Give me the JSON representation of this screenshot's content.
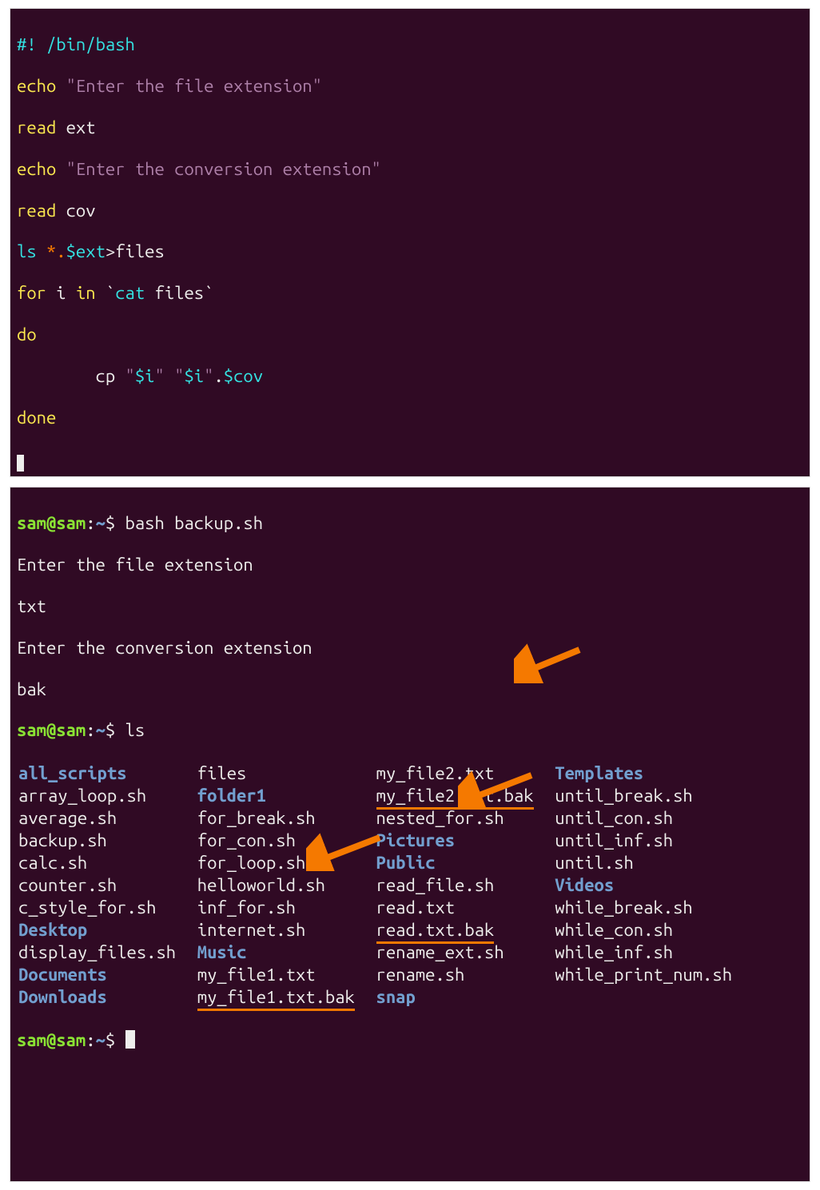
{
  "script": {
    "shebang_prefix": "#! ",
    "shebang_path": "/bin/bash",
    "echo1_cmd": "echo ",
    "echo1_str": "\"Enter the file extension\"",
    "read1_cmd": "read ",
    "read1_arg": "ext",
    "echo2_cmd": "echo ",
    "echo2_str": "\"Enter the conversion extension\"",
    "read2_cmd": "read ",
    "read2_arg": "cov",
    "ls_cmd": "ls ",
    "ls_glob": "*.",
    "ls_var": "$ext",
    "ls_redir": ">",
    "ls_target": "files",
    "for_kw": "for",
    "for_var": " i ",
    "in_kw": "in",
    "for_tick_open": " `",
    "cat_cmd": "cat",
    "cat_arg": " files",
    "for_tick_close": "`",
    "do_kw": "do",
    "cp_indent": "        cp ",
    "cp_q1": "\"",
    "cp_var_i1": "$i",
    "cp_q2": "\"",
    "cp_sp": " ",
    "cp_q3": "\"",
    "cp_var_i2": "$i",
    "cp_q4": "\"",
    "cp_dot": ".",
    "cp_var_cov": "$cov",
    "done_kw": "done"
  },
  "term": {
    "prompt_user": "sam@sam",
    "prompt_sep": ":",
    "prompt_path": "~",
    "prompt_dollar": "$ ",
    "cmd1": "bash backup.sh",
    "p1": "Enter the file extension",
    "in1": "txt",
    "p2": "Enter the conversion extension",
    "in2": "bak",
    "cmd2": "ls",
    "ls": [
      [
        "all_scripts",
        "files",
        "my_file2.txt",
        "Templates"
      ],
      [
        "array_loop.sh",
        "folder1",
        "my_file2.txt.bak",
        "until_break.sh"
      ],
      [
        "average.sh",
        "for_break.sh",
        "nested_for.sh",
        "until_con.sh"
      ],
      [
        "backup.sh",
        "for_con.sh",
        "Pictures",
        "until_inf.sh"
      ],
      [
        "calc.sh",
        "for_loop.sh",
        "Public",
        "until.sh"
      ],
      [
        "counter.sh",
        "helloworld.sh",
        "read_file.sh",
        "Videos"
      ],
      [
        "c_style_for.sh",
        "inf_for.sh",
        "read.txt",
        "while_break.sh"
      ],
      [
        "Desktop",
        "internet.sh",
        "read.txt.bak",
        "while_con.sh"
      ],
      [
        "display_files.sh",
        "Music",
        "rename_ext.sh",
        "while_inf.sh"
      ],
      [
        "Documents",
        "my_file1.txt",
        "rename.sh",
        "while_print_num.sh"
      ],
      [
        "Downloads",
        "my_file1.txt.bak",
        "snap",
        ""
      ]
    ],
    "dirs": [
      "all_scripts",
      "folder1",
      "Pictures",
      "Public",
      "Videos",
      "Desktop",
      "Music",
      "Documents",
      "Downloads",
      "Templates",
      "snap"
    ],
    "underlined": [
      "my_file2.txt.bak",
      "read.txt.bak",
      "my_file1.txt.bak"
    ]
  }
}
